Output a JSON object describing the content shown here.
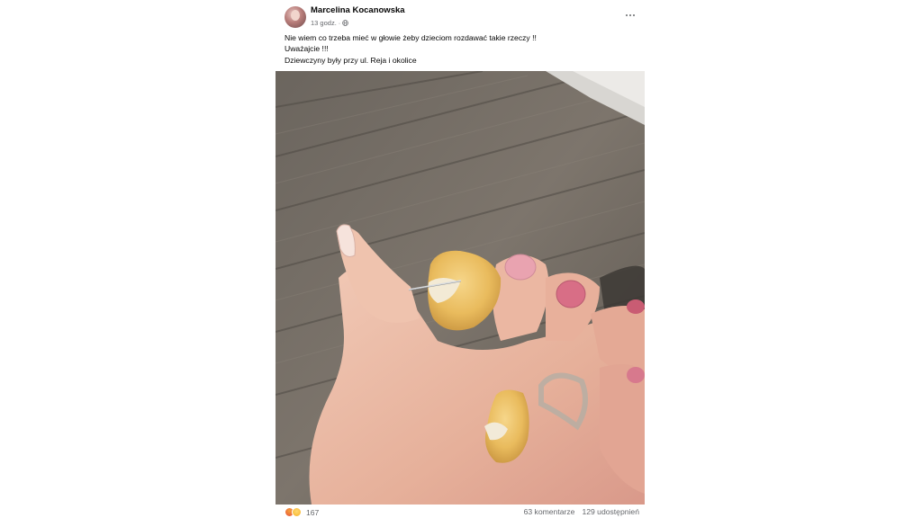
{
  "post": {
    "author": "Marcelina Kocanowska",
    "time": "13 godz.",
    "separator": "·",
    "privacy_icon": "globe-icon",
    "more_icon": "more-options-icon",
    "text_lines": [
      "Nie wiem co trzeba mieć w głowie żeby dzieciom rozdawać takie rzeczy !!",
      "Uważajcie !!!",
      "Dziewczyny były przy ul. Reja i okolice"
    ],
    "photo": "hand-holding-candy-with-needle-image",
    "reactions": {
      "icons": [
        "angry-reaction-icon",
        "wow-reaction-icon"
      ],
      "count": "167"
    },
    "comments": "63 komentarze",
    "shares": "129 udostępnień"
  },
  "colors": {
    "text_primary": "#050505",
    "text_secondary": "#65676b",
    "background": "#ffffff"
  }
}
